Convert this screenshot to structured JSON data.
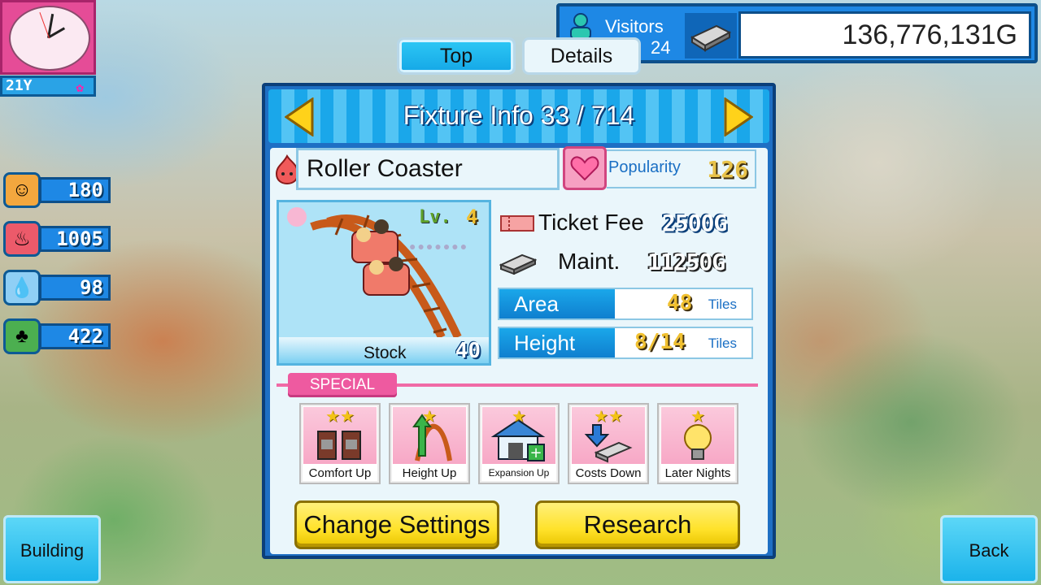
{
  "hud": {
    "year": "21Y",
    "visitors_label": "Visitors",
    "visitors_count": "24",
    "money": "136,776,131G",
    "stats": [
      {
        "icon": "smiley-icon",
        "value": "180"
      },
      {
        "icon": "fire-face-icon",
        "value": "1005"
      },
      {
        "icon": "water-drop-icon",
        "value": "98"
      },
      {
        "icon": "clover-icon",
        "value": "422"
      }
    ]
  },
  "tabs": {
    "top": "Top",
    "details": "Details"
  },
  "dialog": {
    "title": "Fixture Info 33 / 714",
    "name": "Roller Coaster",
    "popularity_label": "Popularity",
    "popularity_value": "126",
    "level_label": "Lv.",
    "level_value": "4",
    "level_dots": "●●●●●●●",
    "stock_label": "Stock",
    "stock_value": "40",
    "ticket_fee_label": "Ticket Fee",
    "ticket_fee_value": "2500G",
    "maint_label": "Maint.",
    "maint_value": "11250G",
    "area_label": "Area",
    "area_value": "48",
    "area_unit": "Tiles",
    "height_label": "Height",
    "height_value": "8/14",
    "height_unit": "Tiles",
    "special_label": "SPECIAL",
    "skills": [
      {
        "label": "Comfort Up",
        "stars": "★★"
      },
      {
        "label": "Height Up",
        "stars": "★"
      },
      {
        "label": "Expansion Up",
        "stars": "★"
      },
      {
        "label": "Costs Down",
        "stars": "★★"
      },
      {
        "label": "Later Nights",
        "stars": "★"
      }
    ],
    "change_settings": "Change Settings",
    "research": "Research"
  },
  "nav": {
    "building": "Building",
    "back": "Back"
  },
  "colors": {
    "panel_blue": "#1e6fc4",
    "accent_pink": "#ee5aa0",
    "button_yellow": "#ffe22a",
    "button_cyan": "#1bb3ea"
  }
}
